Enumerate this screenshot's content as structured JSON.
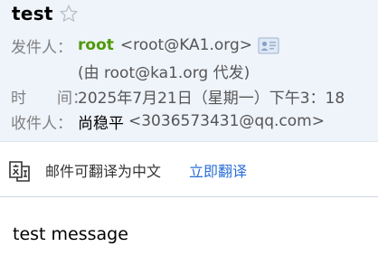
{
  "email": {
    "subject": "test",
    "from": {
      "label": "发件人：",
      "name": "root",
      "address": "<root@KA1.org>",
      "via": "(由 root@ka1.org 代发)"
    },
    "time": {
      "label_left": "时",
      "label_right": "间：",
      "value": "2025年7月21日（星期一）下午3：18"
    },
    "to": {
      "label": "收件人：",
      "name": "尚稳平",
      "address": "<3036573431@qq.com>"
    },
    "body": "test message"
  },
  "translate_bar": {
    "prompt": "邮件可翻译为中文",
    "action": "立即翻译"
  },
  "icons": {
    "star": "star-outline-icon",
    "contact_card": "contact-card-icon",
    "translate": "translate-icon"
  },
  "colors": {
    "header_bg": "#eff3fa",
    "sender_name": "#4e9a06",
    "link": "#2a6fd6",
    "label": "#808080"
  }
}
